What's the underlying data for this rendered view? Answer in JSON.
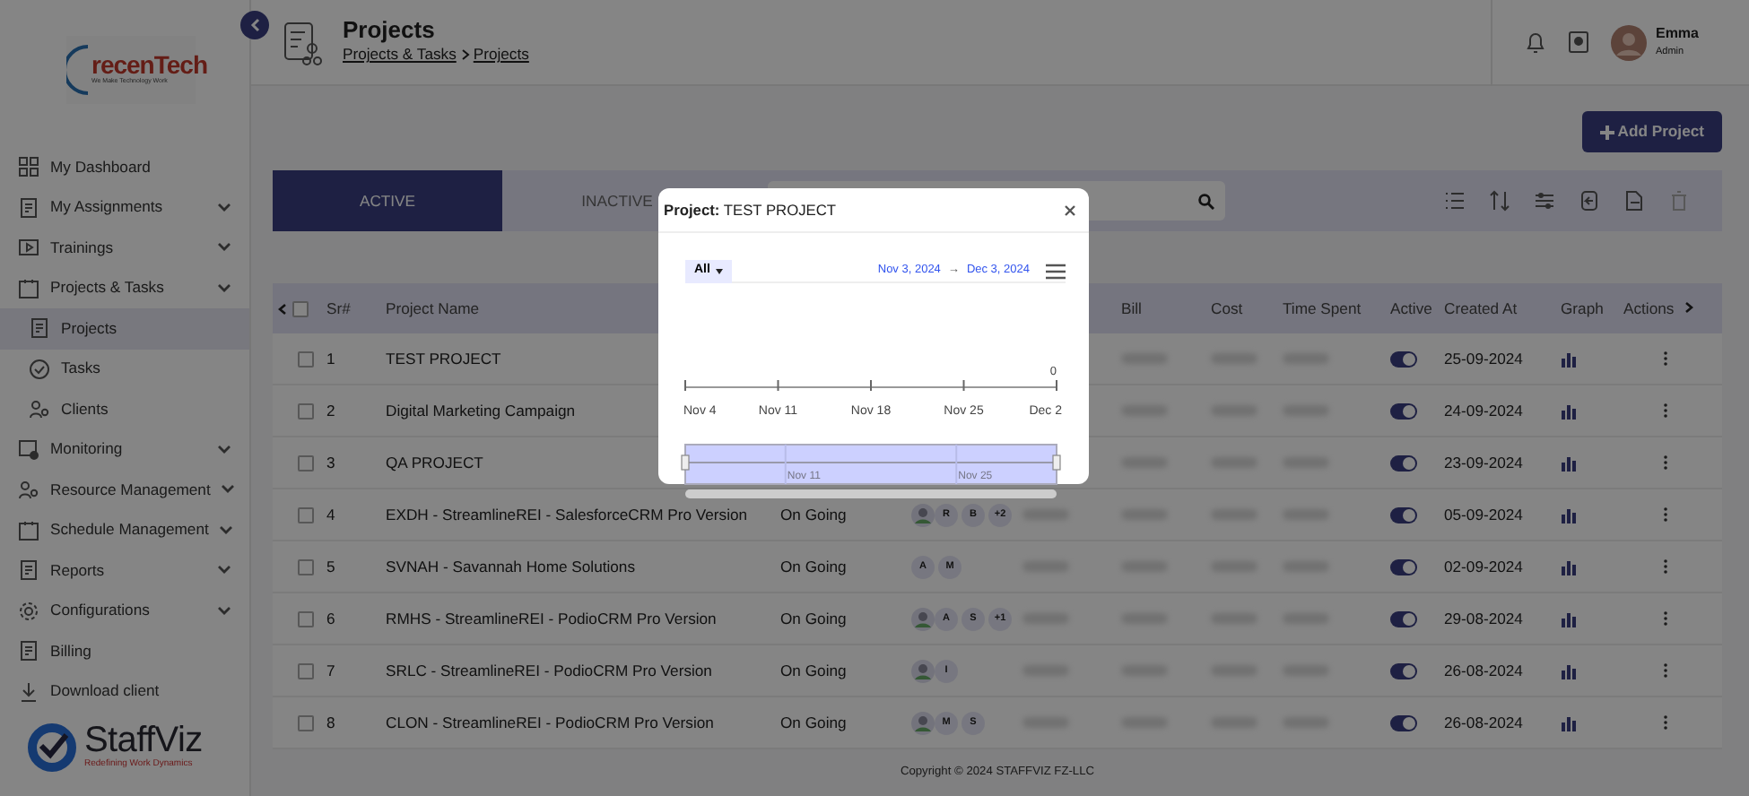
{
  "sidebar": {
    "logo": {
      "name": "recenTech",
      "tagline": "We Make Technology Work"
    },
    "items": [
      {
        "label": "My Dashboard",
        "selected": false
      },
      {
        "label": "My Assignments",
        "selected": false,
        "expandable": true
      },
      {
        "label": "Trainings",
        "selected": false,
        "expandable": true
      },
      {
        "label": "Projects & Tasks",
        "selected": false,
        "expandable": true,
        "children": [
          {
            "label": "Projects",
            "selected": true
          },
          {
            "label": "Tasks",
            "selected": false
          },
          {
            "label": "Clients",
            "selected": false
          }
        ]
      },
      {
        "label": "Monitoring",
        "selected": false,
        "expandable": true
      },
      {
        "label": "Resource Management",
        "selected": false,
        "expandable": true
      },
      {
        "label": "Schedule Management",
        "selected": false,
        "expandable": true
      },
      {
        "label": "Reports",
        "selected": false,
        "expandable": true
      },
      {
        "label": "Configurations",
        "selected": false,
        "expandable": true
      },
      {
        "label": "Billing",
        "selected": false
      },
      {
        "label": "Download client",
        "selected": false
      }
    ],
    "footer_logo": {
      "name": "StaffViz",
      "tagline": "Redefining Work Dynamics"
    }
  },
  "header": {
    "title": "Projects",
    "breadcrumb": [
      "Projects & Tasks",
      "Projects"
    ],
    "user": {
      "name": "Emma",
      "role": "Admin"
    }
  },
  "add_button": "Add Project",
  "tabs": [
    {
      "label": "ACTIVE",
      "selected": true
    },
    {
      "label": "INACTIVE",
      "selected": false
    }
  ],
  "table": {
    "select_all_checked": false,
    "columns": [
      {
        "kind": "sr",
        "label": "Sr#"
      },
      {
        "kind": "name",
        "label": "Project Name"
      },
      {
        "kind": "bill",
        "label": "Bill"
      },
      {
        "kind": "cost",
        "label": "Cost"
      },
      {
        "kind": "time",
        "label": "Time Spent"
      },
      {
        "kind": "active",
        "label": "Active"
      },
      {
        "kind": "created",
        "label": "Created At"
      },
      {
        "kind": "graph",
        "label": "Graph"
      },
      {
        "kind": "actions",
        "label": "Actions"
      }
    ],
    "rows": [
      {
        "sr": "1",
        "name": "TEST PROJECT",
        "active": true,
        "created": "25-09-2024",
        "checked": false
      },
      {
        "sr": "2",
        "name": "Digital Marketing Campaign",
        "active": true,
        "created": "24-09-2024",
        "checked": false
      },
      {
        "sr": "3",
        "name": "QA PROJECT",
        "active": true,
        "created": "23-09-2024",
        "checked": false
      },
      {
        "sr": "4",
        "name": "EXDH - StreamlineREI - SalesforceCRM Pro Version",
        "status": "On Going",
        "members": [
          {
            "kind": "photo"
          },
          {
            "kind": "letter",
            "text": "R"
          },
          {
            "kind": "letter",
            "text": "B"
          },
          {
            "kind": "letter",
            "text": "+2"
          }
        ],
        "active": true,
        "created": "05-09-2024",
        "checked": false
      },
      {
        "sr": "5",
        "name": "SVNAH - Savannah Home Solutions",
        "status": "On Going",
        "members": [
          {
            "kind": "letter",
            "text": "A"
          },
          {
            "kind": "letter",
            "text": "M"
          }
        ],
        "active": true,
        "created": "02-09-2024",
        "checked": false
      },
      {
        "sr": "6",
        "name": "RMHS - StreamlineREI - PodioCRM Pro Version",
        "status": "On Going",
        "members": [
          {
            "kind": "photo"
          },
          {
            "kind": "letter",
            "text": "A"
          },
          {
            "kind": "letter",
            "text": "S"
          },
          {
            "kind": "letter",
            "text": "+1"
          }
        ],
        "active": true,
        "created": "29-08-2024",
        "checked": false
      },
      {
        "sr": "7",
        "name": "SRLC - StreamlineREI - PodioCRM Pro Version",
        "status": "On Going",
        "members": [
          {
            "kind": "photo"
          },
          {
            "kind": "letter",
            "text": "I"
          }
        ],
        "active": true,
        "created": "26-08-2024",
        "checked": false
      },
      {
        "sr": "8",
        "name": "CLON - StreamlineREI - PodioCRM Pro Version",
        "status": "On Going",
        "members": [
          {
            "kind": "photo"
          },
          {
            "kind": "letter",
            "text": "M"
          },
          {
            "kind": "letter",
            "text": "S"
          }
        ],
        "active": true,
        "created": "26-08-2024",
        "checked": false
      }
    ]
  },
  "footer": "Copyright © 2024 STAFFVIZ FZ-LLC",
  "modal": {
    "title_label": "Project:",
    "title": "TEST PROJECT",
    "range_selector": "All",
    "date_from": "Nov 3, 2024",
    "arrow": "→",
    "date_to": "Dec 3, 2024",
    "x_axis_labels": [
      "Nov 4",
      "Nov 11",
      "Nov 18",
      "Nov 25",
      "Dec 2"
    ],
    "y_tick_label": "0",
    "navigator_labels": [
      "Nov 11",
      "Nov 25"
    ]
  }
}
